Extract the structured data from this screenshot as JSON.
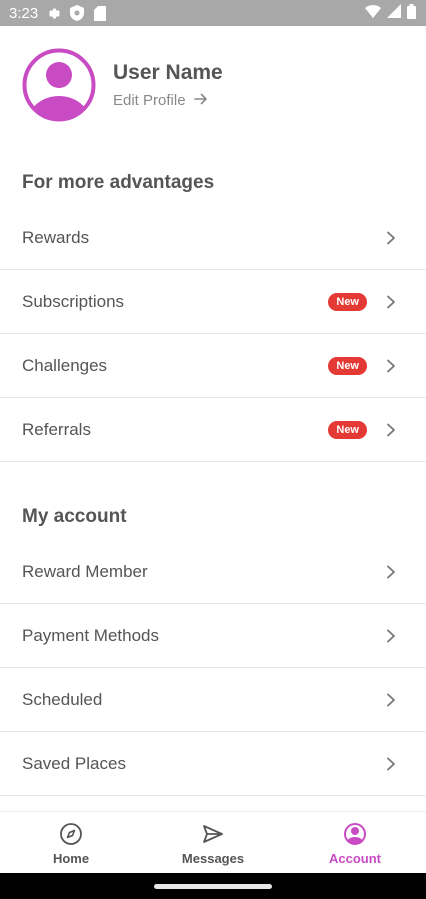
{
  "status_bar": {
    "time": "3:23",
    "left_icons": [
      "gear-icon",
      "shield-icon",
      "sd-card-icon"
    ],
    "right_icons": [
      "wifi-icon",
      "signal-icon",
      "battery-icon"
    ]
  },
  "profile": {
    "user_name": "User Name",
    "edit_label": "Edit Profile",
    "accent_color": "#c94bc3"
  },
  "sections": [
    {
      "title": "For more advantages",
      "items": [
        {
          "label": "Rewards",
          "badge": ""
        },
        {
          "label": "Subscriptions",
          "badge": "New"
        },
        {
          "label": "Challenges",
          "badge": "New"
        },
        {
          "label": "Referrals",
          "badge": "New"
        }
      ]
    },
    {
      "title": "My account",
      "items": [
        {
          "label": "Reward Member",
          "badge": ""
        },
        {
          "label": "Payment Methods",
          "badge": ""
        },
        {
          "label": "Scheduled",
          "badge": ""
        },
        {
          "label": "Saved Places",
          "badge": ""
        }
      ]
    }
  ],
  "bottom_nav": {
    "items": [
      {
        "label": "Home",
        "icon": "compass-icon",
        "active": false
      },
      {
        "label": "Messages",
        "icon": "send-icon",
        "active": false
      },
      {
        "label": "Account",
        "icon": "account-icon",
        "active": true
      }
    ],
    "active_color": "#c94bc3"
  }
}
